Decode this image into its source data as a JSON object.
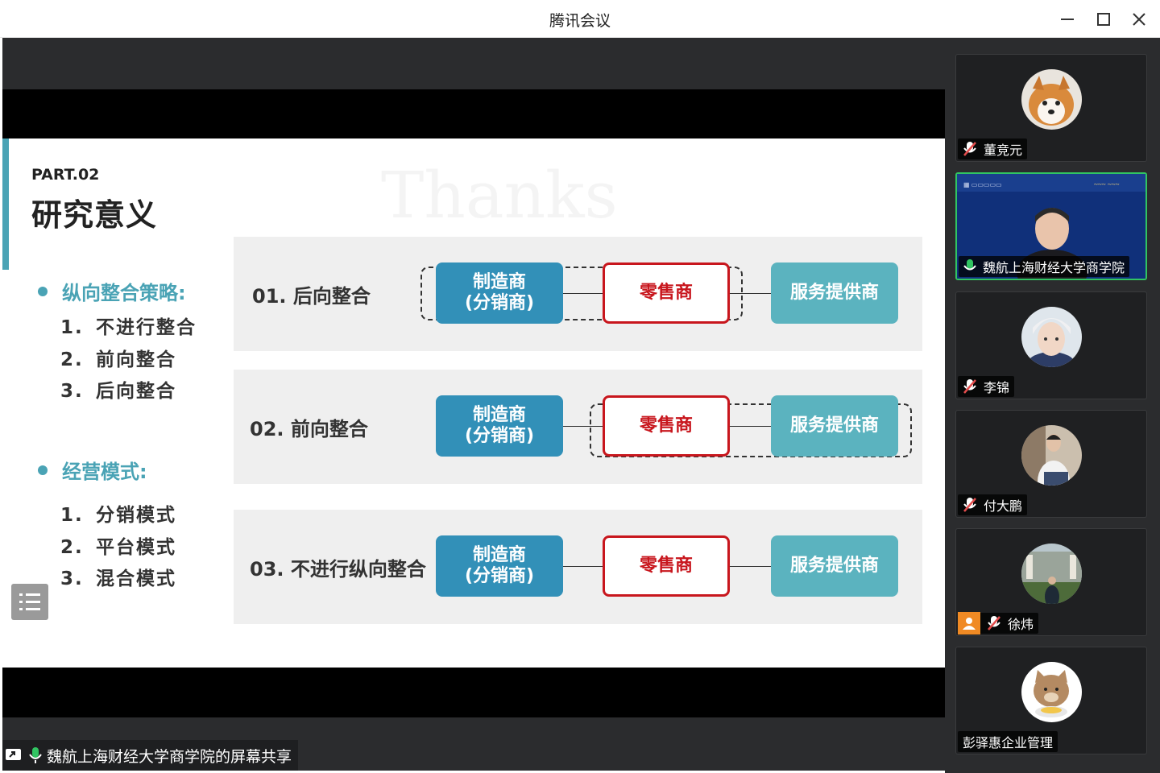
{
  "window": {
    "title": "腾讯会议"
  },
  "slide": {
    "part": "PART.02",
    "heading": "研究意义",
    "watermark": "Thanks",
    "section1": {
      "title": "纵向整合策略:",
      "items": [
        {
          "num": "1.",
          "text": "不进行整合"
        },
        {
          "num": "2.",
          "text": "前向整合"
        },
        {
          "num": "3.",
          "text": "后向整合"
        }
      ]
    },
    "section2": {
      "title": "经营模式:",
      "items": [
        {
          "num": "1.",
          "text": "分销模式"
        },
        {
          "num": "2.",
          "text": "平台模式"
        },
        {
          "num": "3.",
          "text": "混合模式"
        }
      ]
    },
    "rows": [
      {
        "label": "01. 后向整合",
        "manufacturer_line1": "制造商",
        "manufacturer_line2": "(分销商)",
        "retailer": "零售商",
        "service": "服务提供商"
      },
      {
        "label": "02. 前向整合",
        "manufacturer_line1": "制造商",
        "manufacturer_line2": "(分销商)",
        "retailer": "零售商",
        "service": "服务提供商"
      },
      {
        "label": "03. 不进行纵向整合",
        "manufacturer_line1": "制造商",
        "manufacturer_line2": "(分销商)",
        "retailer": "零售商",
        "service": "服务提供商"
      }
    ]
  },
  "sharebar": {
    "text": "魏航上海财经大学商学院的屏幕共享"
  },
  "participants": [
    {
      "name": "董竞元",
      "muted": true
    },
    {
      "name": "魏航上海财经大学商学院",
      "muted": false,
      "speaking": true
    },
    {
      "name": "李锦",
      "muted": true
    },
    {
      "name": "付大鹏",
      "muted": true
    },
    {
      "name": "徐炜",
      "muted": true
    },
    {
      "name": "彭驿惠企业管理",
      "muted": false
    }
  ],
  "colors": {
    "teal": "#4aa3b5",
    "blue": "#3290b8",
    "red": "#c8161d",
    "service": "#5bb3bf",
    "speaking": "#31c462"
  }
}
